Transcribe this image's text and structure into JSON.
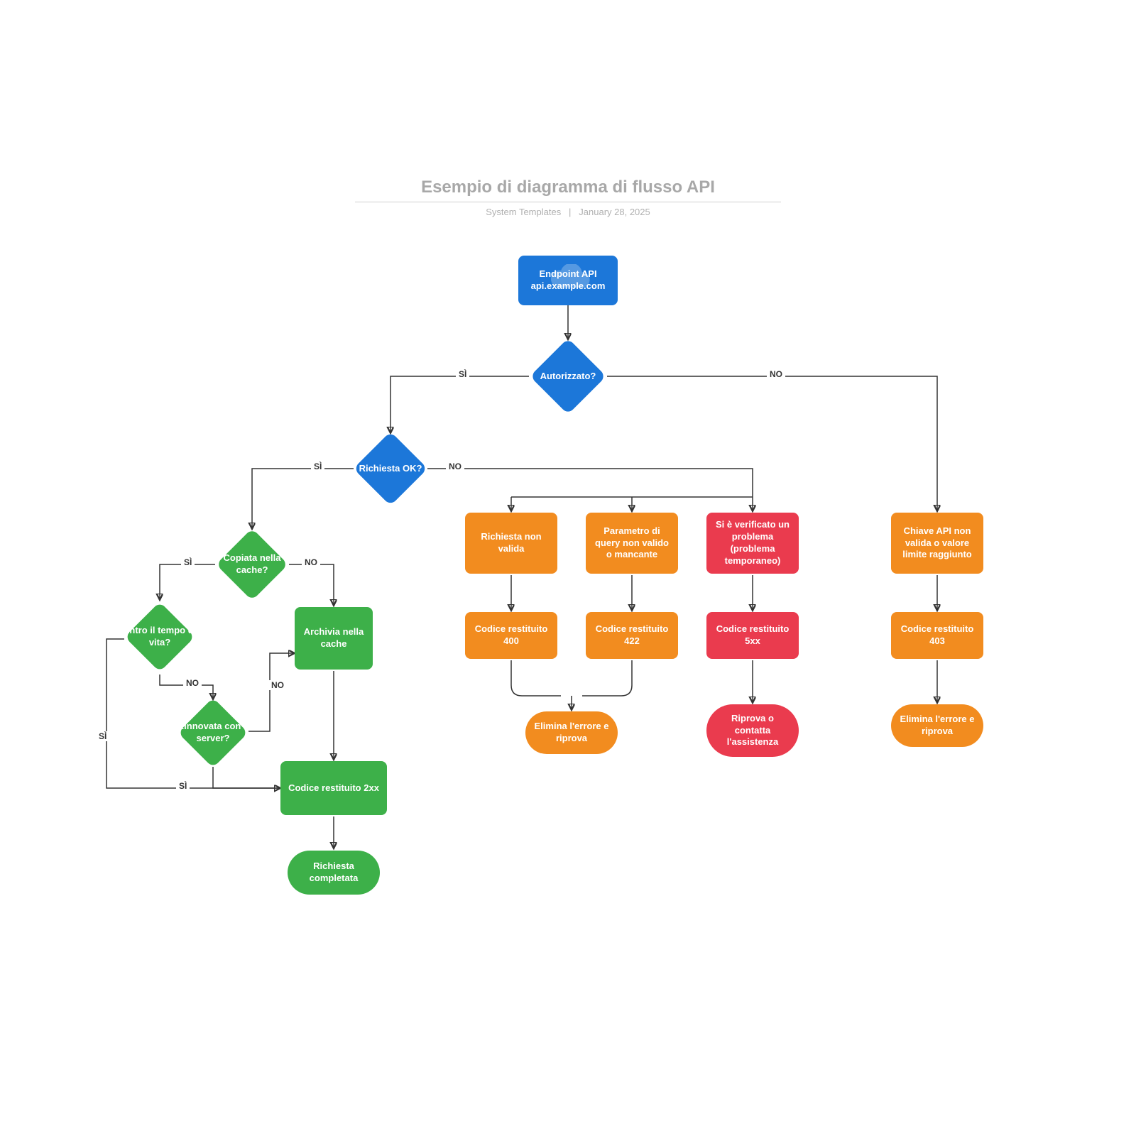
{
  "header": {
    "title": "Esempio di diagramma di flusso API",
    "author": "System Templates",
    "date": "January 28, 2025"
  },
  "colors": {
    "blue": "#1C77D9",
    "green": "#3DB049",
    "orange": "#F28C1F",
    "red": "#EA3B4E"
  },
  "nodes": {
    "endpoint": {
      "label_line1": "Endpoint API",
      "label_line2": "api.example.com"
    },
    "autorizzato": {
      "label": "Autorizzato?"
    },
    "richiesta_ok": {
      "label": "Richiesta OK?"
    },
    "copiata_cache": {
      "label": "Copiata nella cache?"
    },
    "entro_tempo": {
      "label": "Entro il tempo di vita?"
    },
    "rinnovata": {
      "label": "Rinnovata con il server?"
    },
    "archivia": {
      "label": "Archivia nella cache"
    },
    "codice_2xx": {
      "label": "Codice restituito 2xx"
    },
    "completata": {
      "label": "Richiesta completata"
    },
    "non_valida": {
      "label": "Richiesta non valida"
    },
    "param_query": {
      "label": "Parametro di query non valido o mancante"
    },
    "problema_temp": {
      "label": "Si è verificato un problema (problema temporaneo)"
    },
    "chiave_api": {
      "label": "Chiave API non valida o valore limite raggiunto"
    },
    "codice_400": {
      "label": "Codice restituito 400"
    },
    "codice_422": {
      "label": "Codice restituito 422"
    },
    "codice_5xx": {
      "label": "Codice restituito 5xx"
    },
    "codice_403": {
      "label": "Codice restituito 403"
    },
    "elimina_errore_1": {
      "label": "Elimina l'errore e riprova"
    },
    "riprova_assistenza": {
      "label": "Riprova o contatta l'assistenza"
    },
    "elimina_errore_2": {
      "label": "Elimina l'errore e riprova"
    }
  },
  "edge_labels": {
    "si": "SÌ",
    "no": "NO"
  }
}
